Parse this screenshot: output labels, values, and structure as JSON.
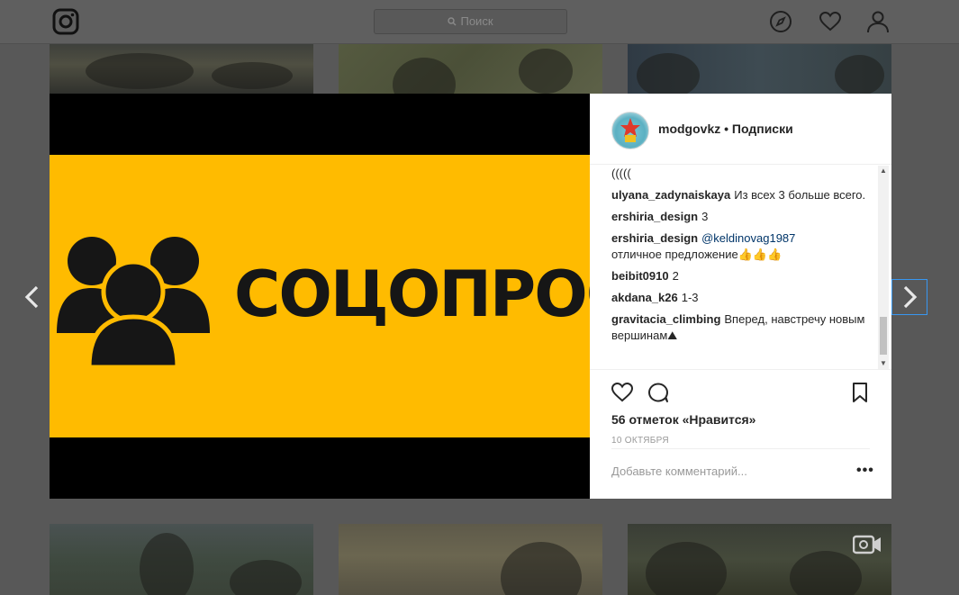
{
  "search": {
    "placeholder": "Поиск",
    "icon": "search-icon"
  },
  "nav": {
    "icons": [
      "instagram-logo-icon",
      "compass-icon",
      "heart-icon",
      "user-icon"
    ]
  },
  "post": {
    "banner_text": "СОЦОПРОС",
    "author": "modgovkz",
    "follow_label": "• Подписки",
    "comments": [
      {
        "text": "((((("
      },
      {
        "user": "ulyana_zadynaiskaya",
        "text": "Из всех 3 больше всего."
      },
      {
        "user": "ershiria_design",
        "text": "3"
      },
      {
        "user": "ershiria_design",
        "mention": "@keldinovag1987",
        "text": "отличное предложение👍👍👍"
      },
      {
        "user": "beibit0910",
        "text": "2"
      },
      {
        "user": "akdana_k26",
        "text": "1-3"
      },
      {
        "user": "gravitacia_climbing",
        "text": "Вперед, навстречу новым вершинам⛰"
      }
    ],
    "likes": "56 отметок «Нравится»",
    "date": "10 октября",
    "comment_placeholder": "Добавьте комментарий...",
    "more_label": "•••"
  },
  "colors": {
    "banner_yellow": "#ffbb00",
    "link_blue": "#003569",
    "focus_blue": "#3897f0"
  }
}
